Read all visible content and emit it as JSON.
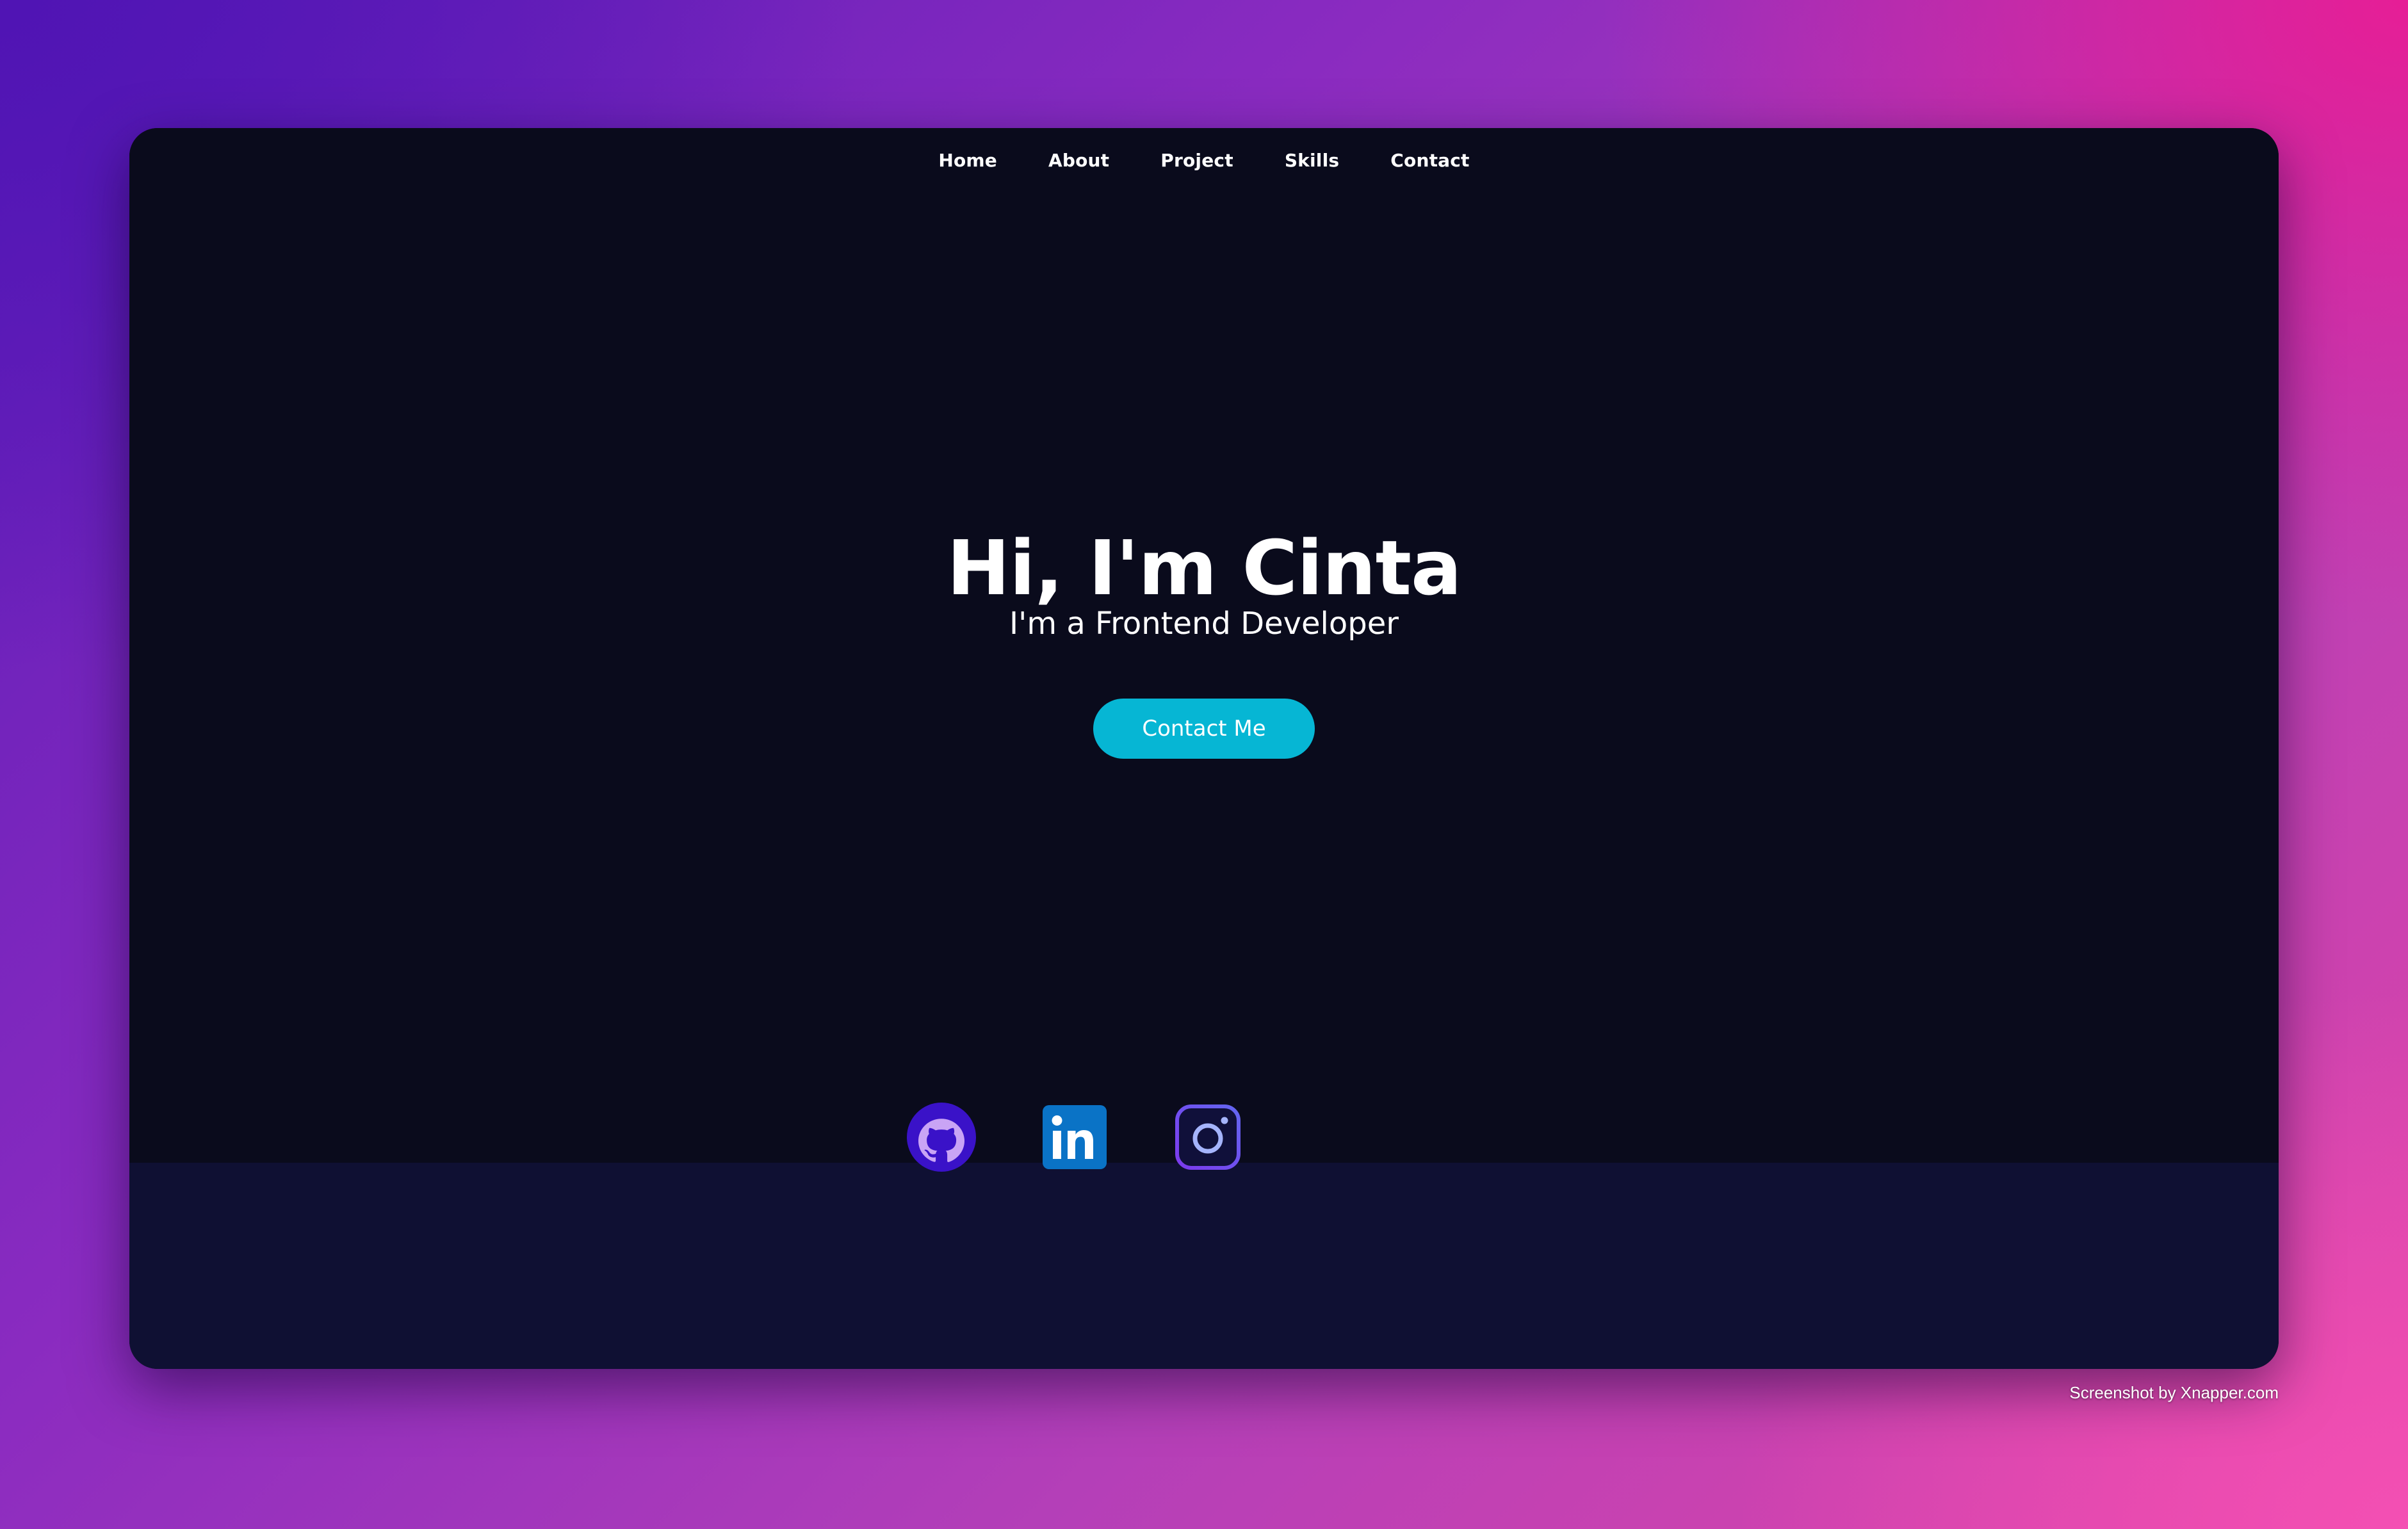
{
  "nav": {
    "items": [
      {
        "label": "Home"
      },
      {
        "label": "About"
      },
      {
        "label": "Project"
      },
      {
        "label": "Skills"
      },
      {
        "label": "Contact"
      }
    ]
  },
  "hero": {
    "title": "Hi, I'm Cinta",
    "subtitle": "I'm a Frontend Developer",
    "cta_label": "Contact Me"
  },
  "footer": {
    "socials": [
      {
        "name": "github",
        "icon": "github-icon"
      },
      {
        "name": "linkedin",
        "icon": "linkedin-icon"
      },
      {
        "name": "instagram",
        "icon": "instagram-icon"
      }
    ]
  },
  "watermark": "Screenshot by Xnapper.com",
  "colors": {
    "background": "#0a0b1c",
    "footer": "#0f1033",
    "accent": "#06b6d4"
  }
}
